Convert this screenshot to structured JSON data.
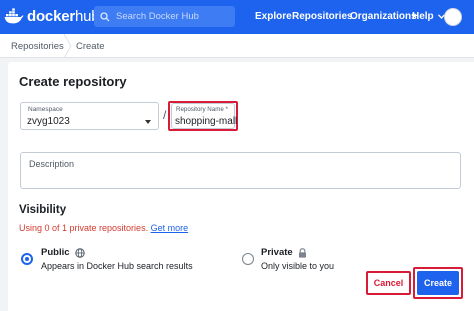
{
  "header": {
    "logo_text_bold": "docker",
    "logo_text_light": "hub",
    "search_placeholder": "Search Docker Hub",
    "nav": {
      "explore": "Explore",
      "repositories": "Repositories",
      "organizations": "Organizations",
      "help": "Help"
    }
  },
  "breadcrumb": {
    "repositories": "Repositories",
    "create": "Create"
  },
  "form": {
    "title": "Create repository",
    "namespace": {
      "label": "Namespace",
      "value": "zvyg1023"
    },
    "separator": "/",
    "repository_name": {
      "label": "Repository Name *",
      "value": "shopping-mall"
    },
    "description": {
      "placeholder": "Description"
    },
    "visibility": {
      "title": "Visibility",
      "usage_text": "Using 0 of 1 private repositories.",
      "get_more": "Get more",
      "public": {
        "title": "Public",
        "description": "Appears in Docker Hub search results",
        "selected": true
      },
      "private": {
        "title": "Private",
        "description": "Only visible to you",
        "selected": false
      }
    },
    "buttons": {
      "cancel": "Cancel",
      "create": "Create"
    }
  },
  "colors": {
    "brand_blue": "#1d63ed",
    "highlight_red": "#d81b36",
    "warning_red": "#d53a2f"
  }
}
